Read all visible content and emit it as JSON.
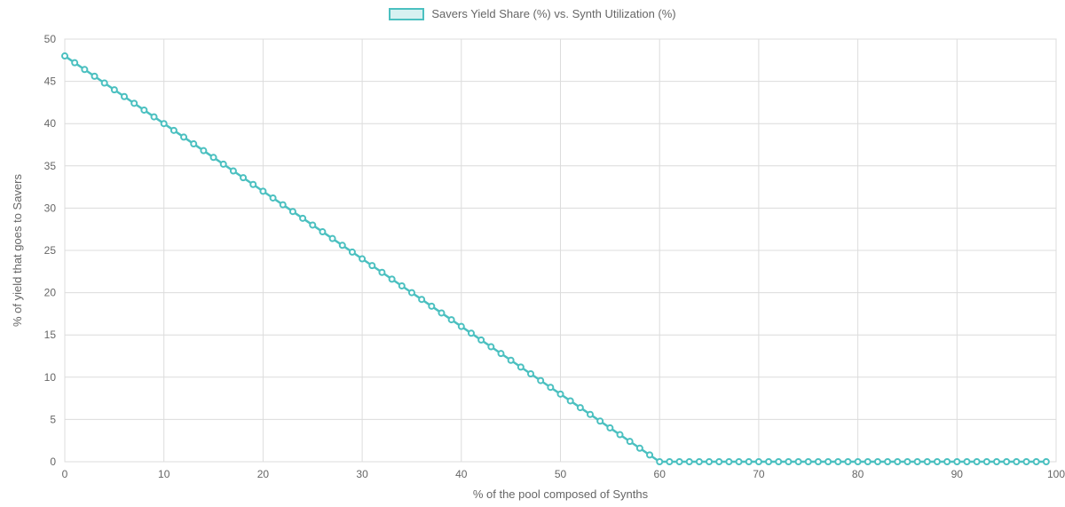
{
  "chart_data": {
    "type": "line",
    "xlabel": "% of the pool composed of Synths",
    "ylabel": "% of yield that goes to Savers",
    "legend": "Savers Yield Share (%) vs. Synth Utilization (%)",
    "xlim": [
      0,
      100
    ],
    "ylim": [
      0,
      50
    ],
    "x_ticks": [
      0,
      10,
      20,
      30,
      40,
      50,
      60,
      70,
      80,
      90,
      100
    ],
    "y_ticks": [
      0,
      5,
      10,
      15,
      20,
      25,
      30,
      35,
      40,
      45,
      50
    ],
    "grid": true,
    "series": [
      {
        "name": "Savers Yield Share (%) vs. Synth Utilization (%)",
        "color": "#4bc0c0",
        "x": [
          0,
          1,
          2,
          3,
          4,
          5,
          6,
          7,
          8,
          9,
          10,
          11,
          12,
          13,
          14,
          15,
          16,
          17,
          18,
          19,
          20,
          21,
          22,
          23,
          24,
          25,
          26,
          27,
          28,
          29,
          30,
          31,
          32,
          33,
          34,
          35,
          36,
          37,
          38,
          39,
          40,
          41,
          42,
          43,
          44,
          45,
          46,
          47,
          48,
          49,
          50,
          51,
          52,
          53,
          54,
          55,
          56,
          57,
          58,
          59,
          60,
          61,
          62,
          63,
          64,
          65,
          66,
          67,
          68,
          69,
          70,
          71,
          72,
          73,
          74,
          75,
          76,
          77,
          78,
          79,
          80,
          81,
          82,
          83,
          84,
          85,
          86,
          87,
          88,
          89,
          90,
          91,
          92,
          93,
          94,
          95,
          96,
          97,
          98,
          99
        ],
        "y": [
          48,
          47.2,
          46.4,
          45.6,
          44.8,
          44,
          43.2,
          42.4,
          41.6,
          40.8,
          40,
          39.2,
          38.4,
          37.6,
          36.8,
          36,
          35.2,
          34.4,
          33.6,
          32.8,
          32,
          31.2,
          30.4,
          29.6,
          28.8,
          28,
          27.2,
          26.4,
          25.6,
          24.8,
          24,
          23.2,
          22.4,
          21.6,
          20.8,
          20,
          19.2,
          18.4,
          17.6,
          16.8,
          16,
          15.2,
          14.4,
          13.6,
          12.8,
          12,
          11.2,
          10.4,
          9.6,
          8.8,
          8,
          7.2,
          6.4,
          5.6,
          4.8,
          4,
          3.2,
          2.4,
          1.6,
          0.8,
          0,
          0,
          0,
          0,
          0,
          0,
          0,
          0,
          0,
          0,
          0,
          0,
          0,
          0,
          0,
          0,
          0,
          0,
          0,
          0,
          0,
          0,
          0,
          0,
          0,
          0,
          0,
          0,
          0,
          0,
          0,
          0,
          0,
          0,
          0,
          0,
          0,
          0,
          0,
          0
        ]
      }
    ]
  }
}
